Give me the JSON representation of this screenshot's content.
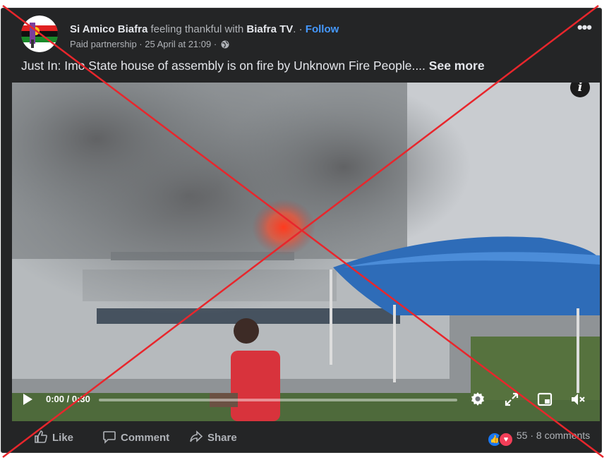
{
  "post": {
    "author": "Si Amico Biafra",
    "activity": "feeling thankful with",
    "tagged_page": "Biafra TV",
    "follow_label": "Follow",
    "partnership": "Paid partnership",
    "timestamp": "25 April at 21:09",
    "caption": "Just In: Imo State house of assembly is on fire by Unknown Fire People....",
    "see_more": "See more"
  },
  "video": {
    "time": "0:00 / 0:30",
    "progress": 0,
    "icons": [
      "play-icon",
      "settings-icon",
      "fullscreen-icon",
      "picture-in-picture-icon",
      "volume-muted-icon",
      "info-icon"
    ]
  },
  "footer": {
    "like_label": "Like",
    "comment_label": "Comment",
    "share_label": "Share",
    "reaction_count": "55",
    "comments_count": "8 comments",
    "separator": "·"
  },
  "overlay": {
    "color": "#e8262c",
    "description": "false-claim-cross"
  },
  "colors": {
    "card_bg": "#242526",
    "text": "#e4e6eb",
    "secondary": "#b0b3b8",
    "link": "#4599ff"
  }
}
